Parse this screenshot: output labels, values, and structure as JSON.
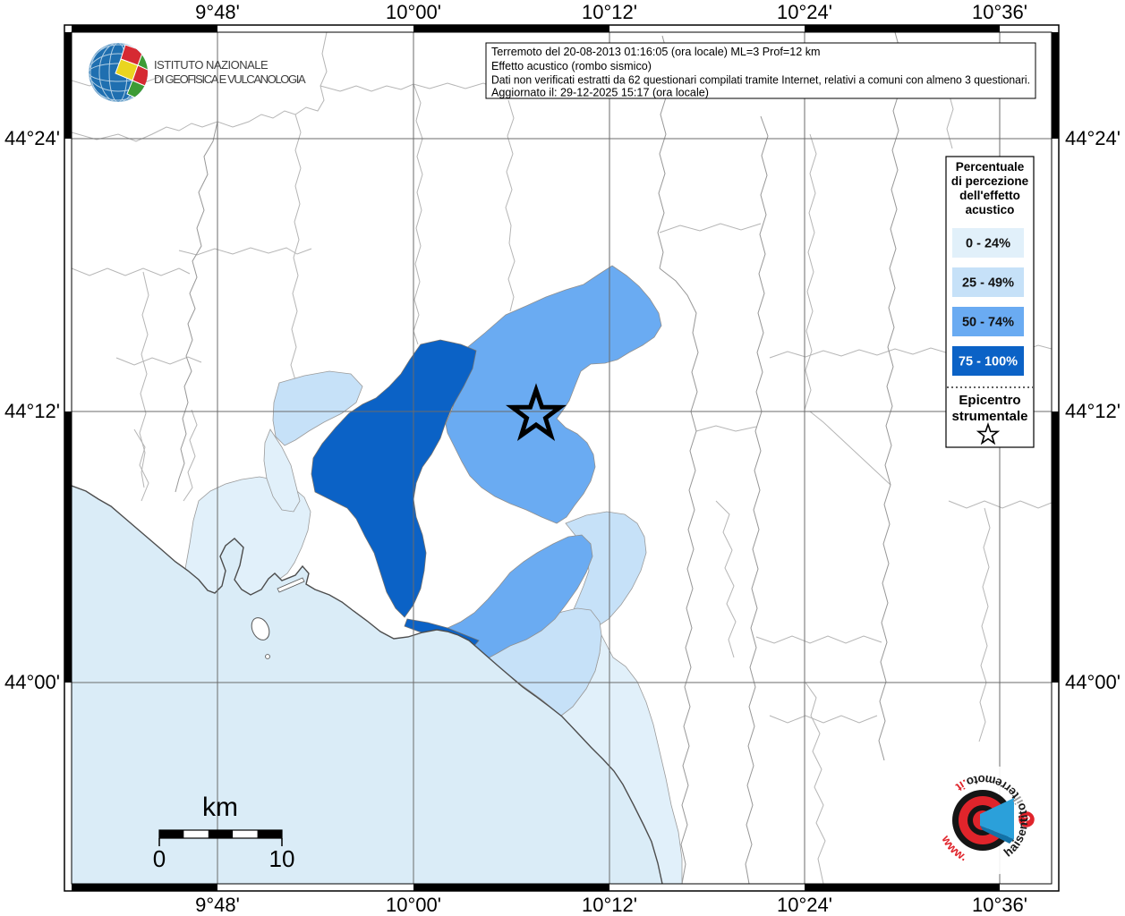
{
  "axes": {
    "top": [
      "9°48'",
      "10°00'",
      "10°12'",
      "10°24'",
      "10°36'"
    ],
    "bottom": [
      "9°48'",
      "10°00'",
      "10°12'",
      "10°24'",
      "10°36'"
    ],
    "left": [
      "44°24'",
      "44°12'",
      "44°00'"
    ],
    "right": [
      "44°24'",
      "44°12'",
      "44°00'"
    ]
  },
  "info_box": {
    "line1": "Terremoto del 20-08-2013 01:16:05 (ora locale) ML=3 Prof=12 km",
    "line2": "Effetto acustico (rombo sismico)",
    "line3": "Dati non verificati estratti da 62 questionari compilati tramite Internet, relativi a comuni con almeno 3 questionari.",
    "line4": "Aggiornato il: 29-12-2025 15:17 (ora locale)"
  },
  "ingv_logo": {
    "line1": "ISTITUTO NAZIONALE",
    "line2": "DI GEOFISICA E VULCANOLOGIA"
  },
  "legend": {
    "title_line1": "Percentuale",
    "title_line2": "di percezione",
    "title_line3": "dell'effetto",
    "title_line4": "acustico",
    "classes": [
      {
        "label": "0 - 24%",
        "color": "#e1f0fa",
        "text_color": "#111111"
      },
      {
        "label": "25 - 49%",
        "color": "#c6e1f8",
        "text_color": "#111111"
      },
      {
        "label": "50 - 74%",
        "color": "#6aabf2",
        "text_color": "#111111"
      },
      {
        "label": "75 - 100%",
        "color": "#0b62c6",
        "text_color": "#ffffff"
      }
    ],
    "epicenter_line1": "Epicentro",
    "epicenter_line2": "strumentale"
  },
  "scale_bar": {
    "unit": "km",
    "start_label": "0",
    "end_label": "10"
  },
  "watermark": {
    "www": "www.",
    "hai": "haisentito",
    "il": "il",
    "terremoto": "terremoto",
    "dot_it": ".it",
    "question": "?"
  },
  "map": {
    "sea_color": "#daecf7",
    "land_color": "#ffffff",
    "border_color": "#b5b5b5",
    "border_color_dark": "#979797",
    "grid_color": "#6b6b6b",
    "coast_color": "#4d4d4d",
    "class_colors": {
      "c1": "#e1f0fa",
      "c2": "#c6e1f8",
      "c3": "#6aabf2",
      "c4": "#0b62c6"
    }
  }
}
